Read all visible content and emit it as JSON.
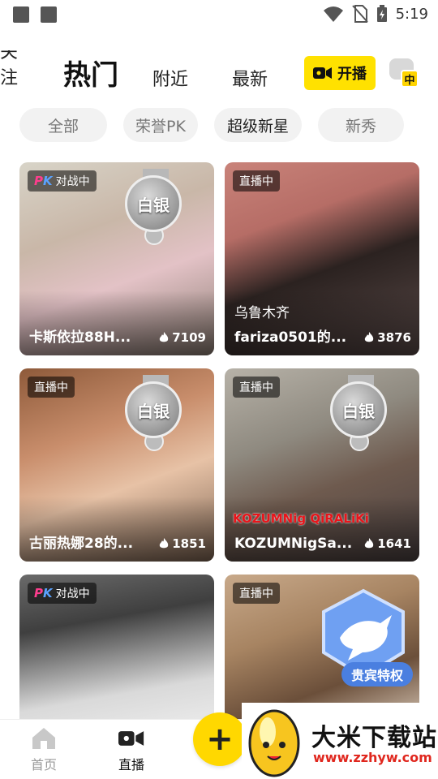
{
  "status_bar": {
    "time": "5:19",
    "left_icons": [
      "image-icon",
      "a-badge-icon"
    ],
    "right_icons": [
      "wifi-icon",
      "no-sim-icon",
      "battery-charging-icon"
    ]
  },
  "top_tabs": {
    "follow": "关注",
    "hot": "热门",
    "nearby": "附近",
    "latest": "最新",
    "go_live": "开播",
    "lang_badge": "中"
  },
  "filters": [
    "全部",
    "荣誉PK",
    "超级新星",
    "新秀"
  ],
  "cards": [
    {
      "badge": "对战中",
      "badge_type": "pk",
      "title": "卡斯依拉88H...",
      "heat": "7109",
      "medal": "白银"
    },
    {
      "badge": "直播中",
      "badge_type": "live",
      "subtitle": "乌鲁木齐",
      "title": "fariza0501的...",
      "heat": "3876"
    },
    {
      "badge": "直播中",
      "badge_type": "live",
      "title": "古丽热娜28的...",
      "heat": "1851",
      "medal": "白银"
    },
    {
      "badge": "直播中",
      "badge_type": "live",
      "title": "KOZUMNigSa...",
      "heat": "1641",
      "medal": "白银",
      "overlay_text": "KOZUMNig QiRALiKi"
    },
    {
      "badge": "对战中",
      "badge_type": "pk",
      "title": "",
      "heat": ""
    },
    {
      "badge": "直播中",
      "badge_type": "live",
      "title": "",
      "heat": "",
      "vip_label": "贵宾特权"
    }
  ],
  "bottom_nav": {
    "home": "首页",
    "live": "直播",
    "plus": "+"
  },
  "watermark": {
    "name": "大米下载站",
    "url": "www.zzhyw.com"
  },
  "colors": {
    "accent_yellow": "#ffe100",
    "chip_bg": "#f2f2f2",
    "watermark_red": "#e0271e",
    "vip_blue": "#4a7fe0"
  }
}
